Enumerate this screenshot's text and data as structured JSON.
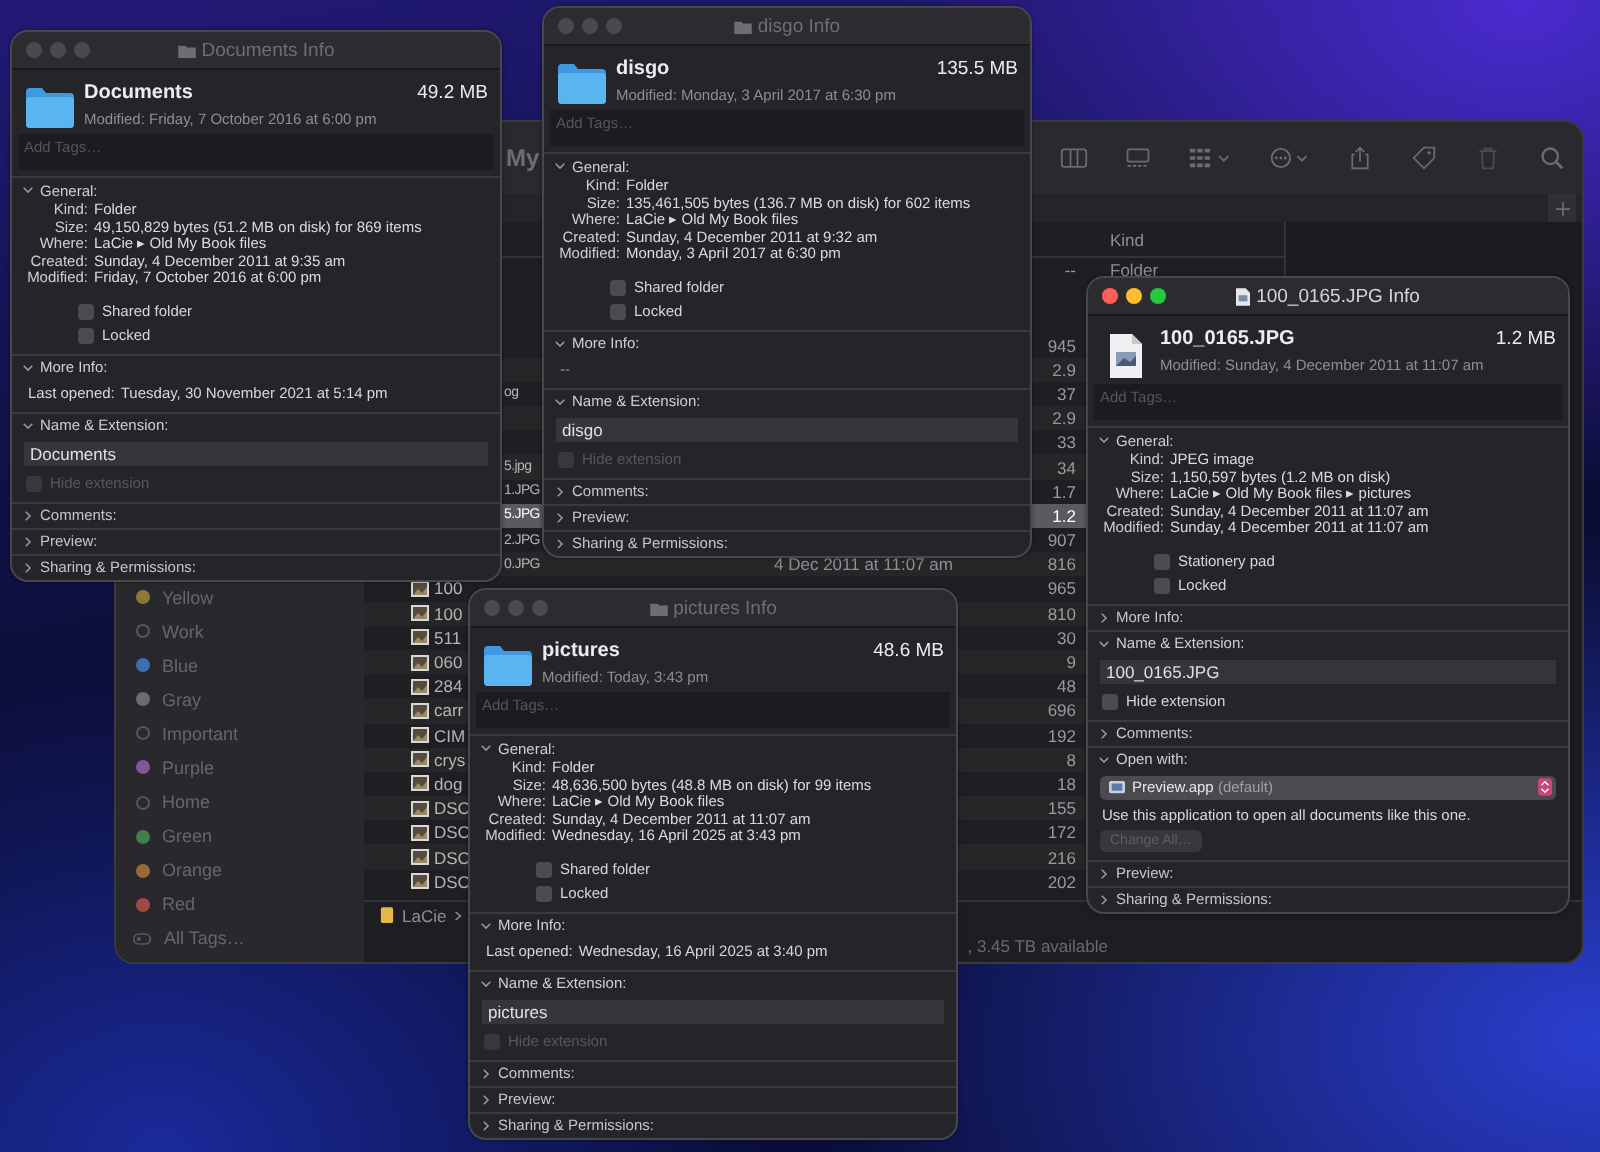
{
  "finder": {
    "title": "My",
    "sidebar_tags": [
      {
        "kind": "tag",
        "label": "Yellow",
        "color": "#8a7a35"
      },
      {
        "kind": "tag",
        "label": "Work"
      },
      {
        "kind": "tag",
        "label": "Blue",
        "color": "#3d6fb0"
      },
      {
        "kind": "tag",
        "label": "Gray",
        "color": "#6c6c70"
      },
      {
        "kind": "tag",
        "label": "Important"
      },
      {
        "kind": "tag",
        "label": "Purple",
        "color": "#7a5a9a"
      },
      {
        "kind": "tag",
        "label": "Home"
      },
      {
        "kind": "tag",
        "label": "Green",
        "color": "#3f7f4a"
      },
      {
        "kind": "tag",
        "label": "Orange",
        "color": "#9a6a35"
      },
      {
        "kind": "tag",
        "label": "Red",
        "color": "#a04a48"
      },
      {
        "kind": "all",
        "label": "All Tags…"
      }
    ],
    "columns": [
      {
        "label": "Kind"
      }
    ],
    "folder_row": {
      "size": "--",
      "kind_text": "Folder"
    },
    "rows": [
      {
        "kind": "partial",
        "size": "945",
        "selected": false
      },
      {
        "kind": "partial",
        "size": "2.9",
        "selected": false
      },
      {
        "kind": "partial",
        "name": "og",
        "size": "37",
        "selected": false
      },
      {
        "kind": "partial",
        "size": "2.9",
        "selected": false
      },
      {
        "kind": "partial",
        "size": "33",
        "selected": false
      },
      {
        "kind": "partial",
        "name": "5.jpg",
        "size": "34",
        "selected": false
      },
      {
        "kind": "partial",
        "name": "1.JPG",
        "size": "1.7",
        "selected": false
      },
      {
        "kind": "partial",
        "name": "5.JPG",
        "size": "1.2",
        "selected": true
      },
      {
        "kind": "partial",
        "name": "2.JPG",
        "size": "907",
        "selected": false
      },
      {
        "kind": "partial",
        "name": "0.JPG",
        "date": "4 Dec 2011 at 11:07 am",
        "size": "816",
        "selected": false
      },
      {
        "kind": "file",
        "name": "100",
        "size": "965",
        "selected": false
      },
      {
        "kind": "file",
        "name": "100",
        "size": "810",
        "selected": false
      },
      {
        "kind": "file",
        "name": "511",
        "size": "30",
        "selected": false
      },
      {
        "kind": "file",
        "name": "060",
        "size": "9",
        "selected": false
      },
      {
        "kind": "file",
        "name": "284",
        "size": "48",
        "selected": false
      },
      {
        "kind": "file",
        "name": "carr",
        "size": "696",
        "selected": false
      },
      {
        "kind": "file",
        "name": "CIM",
        "size": "192",
        "selected": false
      },
      {
        "kind": "file",
        "name": "crys",
        "size": "8",
        "selected": false
      },
      {
        "kind": "file",
        "name": "dog",
        "size": "18",
        "selected": false
      },
      {
        "kind": "file",
        "name": "DSC",
        "size": "155",
        "selected": false
      },
      {
        "kind": "file",
        "name": "DSC",
        "size": "172",
        "selected": false
      },
      {
        "kind": "file",
        "name": "DSC",
        "size": "216",
        "selected": false
      },
      {
        "kind": "file",
        "name": "DSC",
        "size": "202",
        "selected": false
      }
    ],
    "path": [
      {
        "label": "LaCie"
      }
    ],
    "status": ", 3.45 TB available"
  },
  "windows": [
    {
      "title": "Documents Info",
      "active": false,
      "kind": "folder",
      "name": "Documents",
      "size": "49.2 MB",
      "modified": "Modified: Friday, 7 October 2016 at 6:00 pm",
      "tags": {
        "placeholder": "Add Tags…"
      },
      "sections": [
        {
          "kind": "general",
          "label": "General:",
          "expanded": true,
          "rows": [
            {
              "label": "Kind:",
              "value": "Folder"
            },
            {
              "label": "Size:",
              "value": "49,150,829 bytes (51.2 MB on disk) for 869 items"
            },
            {
              "label": "Where:",
              "value": "LaCie ▸ Old My Book files"
            },
            {
              "label": "Created:",
              "value": "Sunday, 4 December 2011 at 9:35 am"
            },
            {
              "label": "Modified:",
              "value": "Friday, 7 October 2016 at 6:00 pm"
            }
          ],
          "checkboxes": [
            {
              "label": "Shared folder",
              "checked": false
            },
            {
              "label": "Locked",
              "checked": false
            }
          ]
        },
        {
          "kind": "info",
          "label": "More Info:",
          "expanded": true,
          "rows": [
            {
              "label": "Last opened:",
              "value": "Tuesday, 30 November 2021 at 5:14 pm"
            }
          ]
        },
        {
          "kind": "name",
          "label": "Name & Extension:",
          "expanded": true,
          "value": "Documents",
          "hide_extension": {
            "label": "Hide extension",
            "checked": false,
            "disabled": true
          }
        },
        {
          "kind": "plain",
          "label": "Comments:",
          "expanded": false
        },
        {
          "kind": "plain",
          "label": "Preview:",
          "expanded": false
        },
        {
          "kind": "plain",
          "label": "Sharing & Permissions:",
          "expanded": false
        }
      ]
    },
    {
      "title": "disgo Info",
      "active": false,
      "kind": "folder",
      "name": "disgo",
      "size": "135.5 MB",
      "modified": "Modified: Monday, 3 April 2017 at 6:30 pm",
      "tags": {
        "placeholder": "Add Tags…"
      },
      "sections": [
        {
          "kind": "general",
          "label": "General:",
          "expanded": true,
          "rows": [
            {
              "label": "Kind:",
              "value": "Folder"
            },
            {
              "label": "Size:",
              "value": "135,461,505 bytes (136.7 MB on disk) for 602 items"
            },
            {
              "label": "Where:",
              "value": "LaCie ▸ Old My Book files"
            },
            {
              "label": "Created:",
              "value": "Sunday, 4 December 2011 at 9:32 am"
            },
            {
              "label": "Modified:",
              "value": "Monday, 3 April 2017 at 6:30 pm"
            }
          ],
          "checkboxes": [
            {
              "label": "Shared folder",
              "checked": false
            },
            {
              "label": "Locked",
              "checked": false
            }
          ]
        },
        {
          "kind": "info",
          "label": "More Info:",
          "expanded": true,
          "text": "--"
        },
        {
          "kind": "name",
          "label": "Name & Extension:",
          "expanded": true,
          "value": "disgo",
          "hide_extension": {
            "label": "Hide extension",
            "checked": false,
            "disabled": true
          }
        },
        {
          "kind": "plain",
          "label": "Comments:",
          "expanded": false
        },
        {
          "kind": "plain",
          "label": "Preview:",
          "expanded": false
        },
        {
          "kind": "plain",
          "label": "Sharing & Permissions:",
          "expanded": false
        }
      ]
    },
    {
      "title": "pictures Info",
      "active": false,
      "kind": "folder",
      "name": "pictures",
      "size": "48.6 MB",
      "modified": "Modified: Today, 3:43 pm",
      "tags": {
        "placeholder": "Add Tags…"
      },
      "sections": [
        {
          "kind": "general",
          "label": "General:",
          "expanded": true,
          "rows": [
            {
              "label": "Kind:",
              "value": "Folder"
            },
            {
              "label": "Size:",
              "value": "48,636,500 bytes (48.8 MB on disk) for 99 items"
            },
            {
              "label": "Where:",
              "value": "LaCie ▸ Old My Book files"
            },
            {
              "label": "Created:",
              "value": "Sunday, 4 December 2011 at 11:07 am"
            },
            {
              "label": "Modified:",
              "value": "Wednesday, 16 April 2025 at 3:43 pm"
            }
          ],
          "checkboxes": [
            {
              "label": "Shared folder",
              "checked": false
            },
            {
              "label": "Locked",
              "checked": false
            }
          ]
        },
        {
          "kind": "info",
          "label": "More Info:",
          "expanded": true,
          "rows": [
            {
              "label": "Last opened:",
              "value": "Wednesday, 16 April 2025 at 3:40 pm"
            }
          ]
        },
        {
          "kind": "name",
          "label": "Name & Extension:",
          "expanded": true,
          "value": "pictures",
          "hide_extension": {
            "label": "Hide extension",
            "checked": false,
            "disabled": true
          }
        },
        {
          "kind": "plain",
          "label": "Comments:",
          "expanded": false
        },
        {
          "kind": "plain",
          "label": "Preview:",
          "expanded": false
        },
        {
          "kind": "plain",
          "label": "Sharing & Permissions:",
          "expanded": false
        }
      ]
    },
    {
      "title": "100_0165.JPG Info",
      "active": true,
      "kind": "image",
      "name": "100_0165.JPG",
      "size": "1.2 MB",
      "modified": "Modified: Sunday, 4 December 2011 at 11:07 am",
      "tags": {
        "placeholder": "Add Tags…"
      },
      "sections": [
        {
          "kind": "general",
          "label": "General:",
          "expanded": true,
          "rows": [
            {
              "label": "Kind:",
              "value": "JPEG image"
            },
            {
              "label": "Size:",
              "value": "1,150,597 bytes (1.2 MB on disk)"
            },
            {
              "label": "Where:",
              "value": "LaCie ▸ Old My Book files ▸ pictures"
            },
            {
              "label": "Created:",
              "value": "Sunday, 4 December 2011 at 11:07 am"
            },
            {
              "label": "Modified:",
              "value": "Sunday, 4 December 2011 at 11:07 am"
            }
          ],
          "checkboxes": [
            {
              "label": "Stationery pad",
              "checked": false
            },
            {
              "label": "Locked",
              "checked": false
            }
          ]
        },
        {
          "kind": "plain",
          "label": "More Info:",
          "expanded": false
        },
        {
          "kind": "name",
          "label": "Name & Extension:",
          "expanded": true,
          "value": "100_0165.JPG",
          "hide_extension": {
            "label": "Hide extension",
            "checked": false,
            "disabled": false
          }
        },
        {
          "kind": "plain",
          "label": "Comments:",
          "expanded": false
        },
        {
          "kind": "open_with",
          "label": "Open with:",
          "expanded": true,
          "app": "Preview.app",
          "app_note": "(default)",
          "description": "Use this application to open all documents like this one.",
          "button": {
            "label": "Change All…",
            "disabled": true
          }
        },
        {
          "kind": "plain",
          "label": "Preview:",
          "expanded": false
        },
        {
          "kind": "plain",
          "label": "Sharing & Permissions:",
          "expanded": false
        }
      ]
    }
  ]
}
